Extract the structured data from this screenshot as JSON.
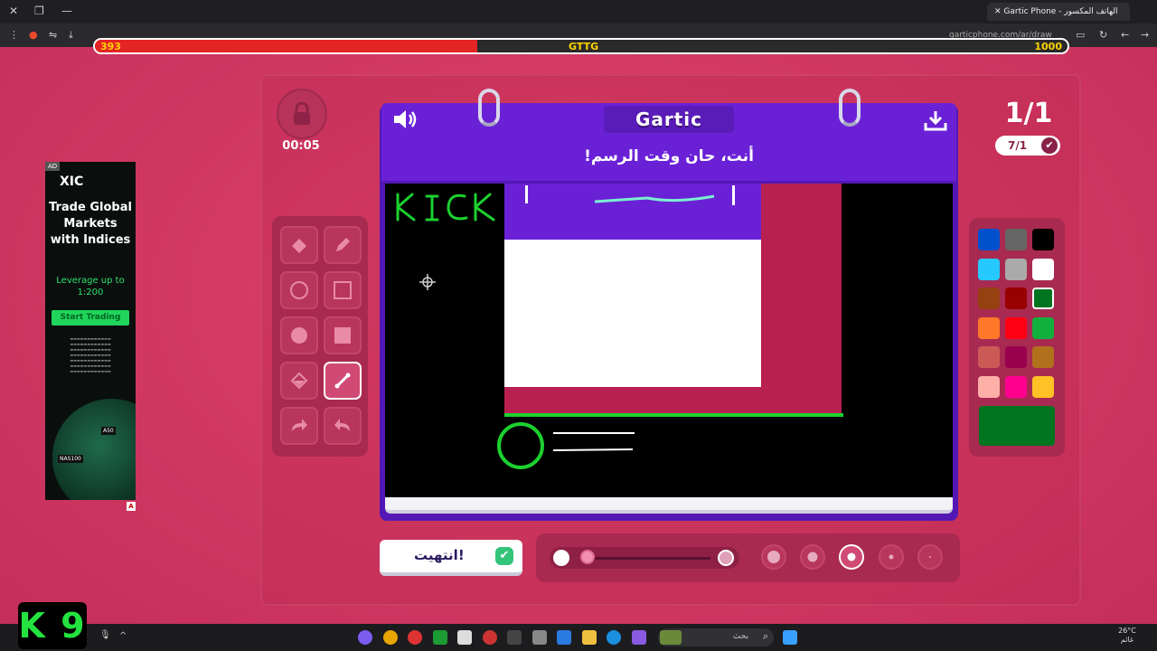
{
  "browser": {
    "tab_title": "Gartic Phone - الهاتف المكسور",
    "url": "garticphone.com/ar/draw"
  },
  "stream_bar": {
    "left_value": "393",
    "center_label": "GTTG",
    "right_value": "1000",
    "progress": 0.393,
    "fill_color": "#e52424"
  },
  "game": {
    "timer": "00:05",
    "round": "1/1",
    "done_count": "7/1",
    "logo": "Gartic",
    "prompt": "أنت، حان وقت الرسم!",
    "done_button": "انتهيت!",
    "tools": [
      {
        "name": "pencil",
        "icon": "pencil-icon"
      },
      {
        "name": "eraser",
        "icon": "eraser-icon"
      },
      {
        "name": "rectangle",
        "icon": "square-icon"
      },
      {
        "name": "ellipse",
        "icon": "circle-icon"
      },
      {
        "name": "filled-rectangle",
        "icon": "filled-square-icon"
      },
      {
        "name": "filled-ellipse",
        "icon": "filled-circle-icon"
      },
      {
        "name": "line",
        "icon": "line-icon",
        "active": true
      },
      {
        "name": "fill-bucket",
        "icon": "bucket-icon"
      },
      {
        "name": "undo",
        "icon": "undo-icon"
      },
      {
        "name": "redo",
        "icon": "redo-icon"
      }
    ],
    "colors": [
      "#000000",
      "#666666",
      "#0050cd",
      "#ffffff",
      "#aaaaaa",
      "#26c9ff",
      "#017420",
      "#990000",
      "#964112",
      "#11b03c",
      "#ff0013",
      "#ff7829",
      "#b0701c",
      "#99004e",
      "#cb5a57",
      "#ffc126",
      "#ff008f",
      "#feafa8"
    ],
    "selected_color": "#017420",
    "opacity": 1.0,
    "brush_size_selected": 3
  },
  "drawing": {
    "text": "KICK",
    "stroke_color": "#1bd12f"
  },
  "ad": {
    "badge": "AD",
    "brand": "XIC",
    "headline": "Trade Global Markets with Indices",
    "subline": "Leverage up to 1:200",
    "cta": "Start Trading",
    "tag1": "A50",
    "tag2": "NAS100"
  },
  "overlay_logo": "K 9",
  "taskbar": {
    "search_placeholder": "بحث",
    "weather": "26°C",
    "weather_desc": "غائم"
  }
}
